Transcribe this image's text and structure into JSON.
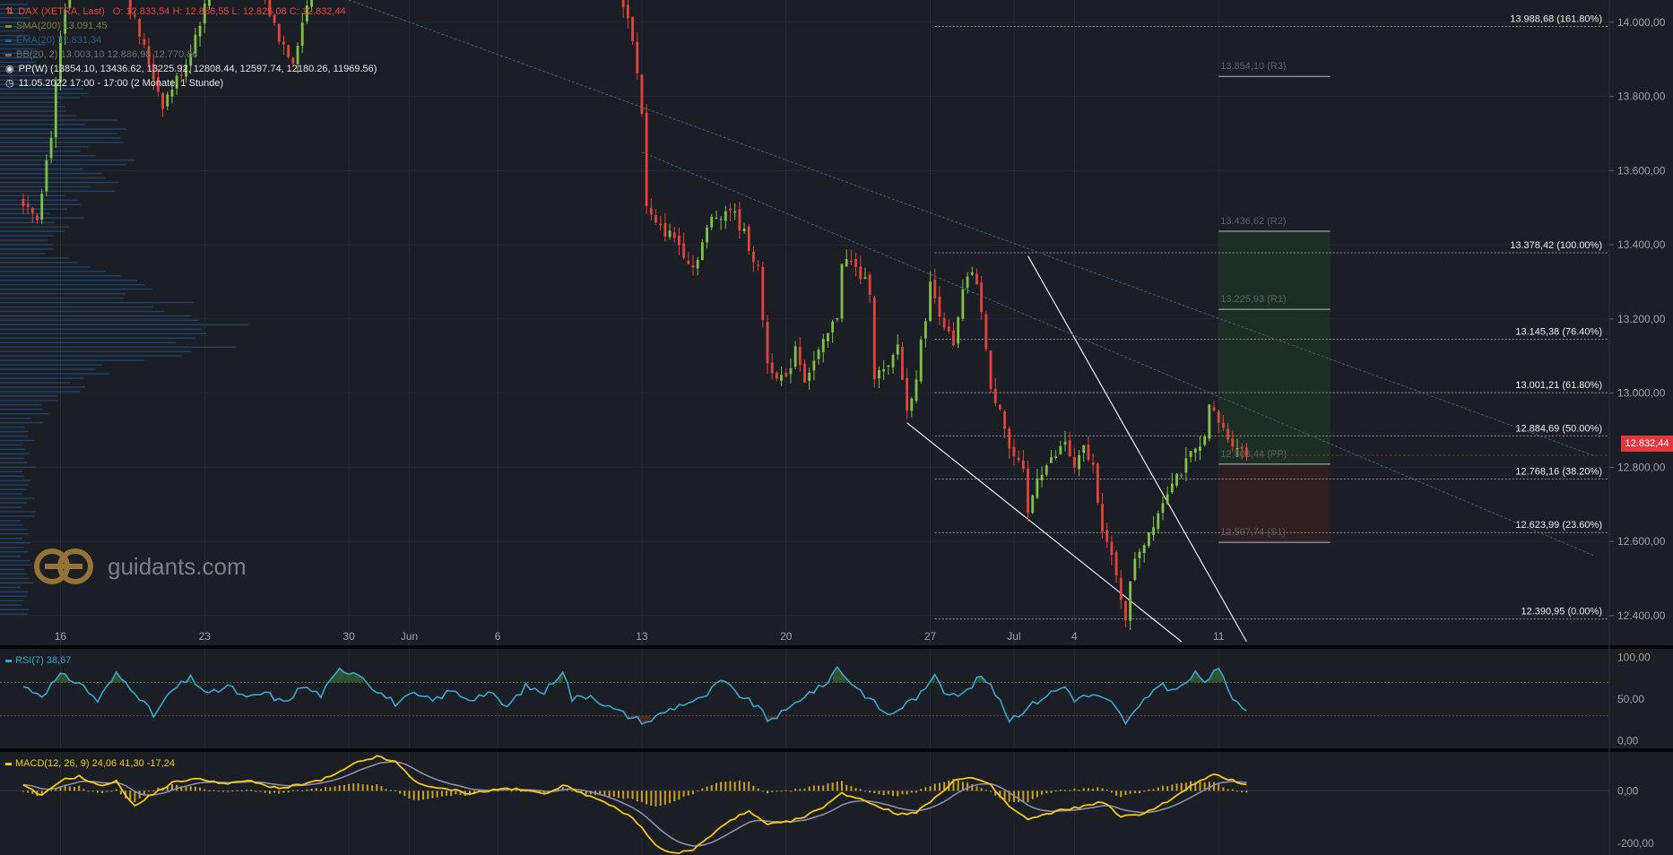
{
  "header": {
    "instrument": "DAX (XETRA, Last)",
    "ohlc": "O: 12.833,54   H: 12.856,55   L: 12.825,08   C: 12.832,44",
    "sma": "SMA(200)  13.091,45",
    "ema": "EMA(20)  12.831,34",
    "bb": "BB(20, 2)  13.003,10  12.886,98  12.770,86",
    "pp": "PP(W)   (13854.10, 13436.62, 13225.92, 12808.44, 12597.74, 12180.26, 11969.56)",
    "period": "11.05.2022 17:00 - 17:00   (2 Monate, 1 Stunde)"
  },
  "logo": {
    "text": "guidants.com"
  },
  "last_price": "12.832,44",
  "colors": {
    "background": "#1b1e24",
    "up": "#7fc04a",
    "down": "#e0443c",
    "rsi": "#3aa6cc",
    "macd": "#f2c816",
    "signal": "#8a8fa8",
    "histogram": "#c9a227",
    "volume_profile": "#1f4c78",
    "price_tag": "#e6383c"
  },
  "chart_data": [
    {
      "type": "candlestick",
      "title": "DAX (XETRA, Last)",
      "y_ticks": [
        "14.000,00",
        "13.800,00",
        "13.600,00",
        "13.400,00",
        "13.200,00",
        "13.000,00",
        "12.800,00",
        "12.600,00",
        "12.400,00"
      ],
      "y_tick_values": [
        14000,
        13800,
        13600,
        13400,
        13200,
        13000,
        12800,
        12600,
        12400
      ],
      "ylim": [
        12320,
        14060
      ],
      "x_ticks": [
        {
          "label": "16",
          "index": 8
        },
        {
          "label": "23",
          "index": 39
        },
        {
          "label": "30",
          "index": 70
        },
        {
          "label": "Jun",
          "index": 83
        },
        {
          "label": "6",
          "index": 102
        },
        {
          "label": "13",
          "index": 133
        },
        {
          "label": "20",
          "index": 164
        },
        {
          "label": "27",
          "index": 195
        },
        {
          "label": "Jul",
          "index": 213
        },
        {
          "label": "4",
          "index": 226
        },
        {
          "label": "11",
          "index": 257
        }
      ],
      "x_range": [
        -5,
        341
      ],
      "anchor_closes": [
        [
          0,
          13520
        ],
        [
          3,
          13480
        ],
        [
          6,
          13700
        ],
        [
          8,
          13950
        ],
        [
          10,
          14100
        ],
        [
          20,
          14150
        ],
        [
          30,
          13780
        ],
        [
          35,
          13890
        ],
        [
          40,
          14080
        ],
        [
          50,
          14120
        ],
        [
          55,
          13960
        ],
        [
          58,
          13900
        ],
        [
          62,
          14100
        ],
        [
          66,
          14140
        ],
        [
          70,
          14200
        ],
        [
          100,
          14300
        ],
        [
          128,
          14100
        ],
        [
          131,
          13960
        ],
        [
          133,
          13760
        ],
        [
          134,
          13500
        ],
        [
          136,
          13450
        ],
        [
          140,
          13420
        ],
        [
          144,
          13340
        ],
        [
          148,
          13470
        ],
        [
          152,
          13500
        ],
        [
          155,
          13430
        ],
        [
          158,
          13330
        ],
        [
          160,
          13080
        ],
        [
          164,
          13030
        ],
        [
          166,
          13130
        ],
        [
          168,
          13040
        ],
        [
          172,
          13130
        ],
        [
          175,
          13210
        ],
        [
          176,
          13360
        ],
        [
          178,
          13350
        ],
        [
          182,
          13280
        ],
        [
          183,
          13050
        ],
        [
          186,
          13060
        ],
        [
          188,
          13130
        ],
        [
          190,
          12950
        ],
        [
          192,
          13050
        ],
        [
          195,
          13290
        ],
        [
          200,
          13120
        ],
        [
          202,
          13270
        ],
        [
          204,
          13330
        ],
        [
          206,
          13230
        ],
        [
          208,
          13000
        ],
        [
          210,
          12970
        ],
        [
          212,
          12850
        ],
        [
          215,
          12780
        ],
        [
          216,
          12670
        ],
        [
          218,
          12780
        ],
        [
          222,
          12830
        ],
        [
          224,
          12870
        ],
        [
          226,
          12790
        ],
        [
          228,
          12850
        ],
        [
          230,
          12800
        ],
        [
          232,
          12640
        ],
        [
          234,
          12550
        ],
        [
          237,
          12400
        ],
        [
          239,
          12560
        ],
        [
          241,
          12600
        ],
        [
          244,
          12680
        ],
        [
          247,
          12770
        ],
        [
          249,
          12790
        ],
        [
          251,
          12830
        ],
        [
          253,
          12850
        ],
        [
          254,
          12900
        ],
        [
          255,
          12960
        ],
        [
          257,
          12920
        ],
        [
          259,
          12880
        ],
        [
          261,
          12860
        ],
        [
          263,
          12832
        ]
      ],
      "fibonacci": [
        {
          "label": "13.988,68 (161.80%)",
          "value": 13988.68
        },
        {
          "label": "13.378,42 (100.00%)",
          "value": 13378.42
        },
        {
          "label": "13.145,38 (76.40%)",
          "value": 13145.38
        },
        {
          "label": "13.001,21 (61.80%)",
          "value": 13001.21
        },
        {
          "label": "12.884,69 (50.00%)",
          "value": 12884.69
        },
        {
          "label": "12.768,16 (38.20%)",
          "value": 12768.16
        },
        {
          "label": "12.623,99 (23.60%)",
          "value": 12623.99
        },
        {
          "label": "12.390,95 (0.00%)",
          "value": 12390.95
        }
      ],
      "pivots": [
        {
          "label": "13.854,10 (R3)",
          "value": 13854.1
        },
        {
          "label": "13.436,62 (R2)",
          "value": 13436.62
        },
        {
          "label": "13.225,93 (R1)",
          "value": 13225.93
        },
        {
          "label": "12.808,44 (PP)",
          "value": 12808.44
        },
        {
          "label": "12.597,74 (S1)",
          "value": 12597.74
        }
      ],
      "trendlines": [
        {
          "name": "channel-upper",
          "from": [
            216,
            13370
          ],
          "to": [
            263,
            12330
          ]
        },
        {
          "name": "channel-lower",
          "from": [
            190,
            12920
          ],
          "to": [
            249,
            12330
          ]
        },
        {
          "name": "long-trend-1",
          "from": [
            70,
            14060
          ],
          "to": [
            338,
            12830
          ]
        },
        {
          "name": "long-trend-2",
          "from": [
            133,
            13650
          ],
          "to": [
            338,
            12560
          ]
        }
      ],
      "last_price": 12832.44
    },
    {
      "type": "line",
      "title": "RSI(7)",
      "value_label": "RSI(7)  38,67",
      "y_ticks": [
        "100,00",
        "50,00",
        "0,00"
      ],
      "y_tick_values": [
        100,
        50,
        0
      ],
      "ylim": [
        -8,
        108
      ],
      "levels": [
        70,
        30
      ],
      "anchors": [
        [
          0,
          65
        ],
        [
          4,
          55
        ],
        [
          8,
          78
        ],
        [
          12,
          70
        ],
        [
          16,
          48
        ],
        [
          20,
          80
        ],
        [
          24,
          60
        ],
        [
          28,
          30
        ],
        [
          32,
          60
        ],
        [
          36,
          75
        ],
        [
          40,
          55
        ],
        [
          44,
          66
        ],
        [
          48,
          50
        ],
        [
          52,
          58
        ],
        [
          56,
          45
        ],
        [
          60,
          65
        ],
        [
          64,
          55
        ],
        [
          68,
          85
        ],
        [
          72,
          82
        ],
        [
          76,
          60
        ],
        [
          80,
          45
        ],
        [
          84,
          55
        ],
        [
          88,
          48
        ],
        [
          92,
          60
        ],
        [
          96,
          50
        ],
        [
          100,
          58
        ],
        [
          104,
          40
        ],
        [
          108,
          65
        ],
        [
          112,
          58
        ],
        [
          116,
          85
        ],
        [
          118,
          50
        ],
        [
          122,
          55
        ],
        [
          126,
          40
        ],
        [
          130,
          30
        ],
        [
          134,
          22
        ],
        [
          138,
          35
        ],
        [
          142,
          45
        ],
        [
          146,
          50
        ],
        [
          150,
          72
        ],
        [
          154,
          55
        ],
        [
          158,
          40
        ],
        [
          160,
          25
        ],
        [
          164,
          35
        ],
        [
          168,
          55
        ],
        [
          172,
          65
        ],
        [
          175,
          88
        ],
        [
          178,
          70
        ],
        [
          182,
          50
        ],
        [
          186,
          30
        ],
        [
          190,
          45
        ],
        [
          194,
          60
        ],
        [
          196,
          82
        ],
        [
          198,
          60
        ],
        [
          202,
          55
        ],
        [
          206,
          78
        ],
        [
          210,
          50
        ],
        [
          212,
          25
        ],
        [
          216,
          40
        ],
        [
          220,
          55
        ],
        [
          224,
          65
        ],
        [
          226,
          50
        ],
        [
          230,
          55
        ],
        [
          234,
          45
        ],
        [
          237,
          22
        ],
        [
          240,
          40
        ],
        [
          244,
          68
        ],
        [
          248,
          60
        ],
        [
          252,
          80
        ],
        [
          254,
          72
        ],
        [
          257,
          85
        ],
        [
          260,
          52
        ],
        [
          263,
          39
        ]
      ]
    },
    {
      "type": "line",
      "title": "MACD(12, 26, 9)",
      "value_label": "MACD(12, 26, 9)  24,06  41,30  -17,24",
      "y_ticks": [
        "0,00",
        "-200,00"
      ],
      "y_tick_values": [
        0,
        -200
      ],
      "ylim": [
        -245,
        145
      ],
      "anchors": [
        [
          0,
          20
        ],
        [
          4,
          -20
        ],
        [
          8,
          40
        ],
        [
          12,
          55
        ],
        [
          16,
          20
        ],
        [
          20,
          35
        ],
        [
          24,
          -60
        ],
        [
          28,
          -10
        ],
        [
          32,
          30
        ],
        [
          36,
          45
        ],
        [
          40,
          40
        ],
        [
          44,
          25
        ],
        [
          48,
          40
        ],
        [
          52,
          20
        ],
        [
          56,
          10
        ],
        [
          60,
          25
        ],
        [
          64,
          40
        ],
        [
          68,
          70
        ],
        [
          72,
          110
        ],
        [
          76,
          130
        ],
        [
          80,
          110
        ],
        [
          84,
          40
        ],
        [
          88,
          10
        ],
        [
          92,
          5
        ],
        [
          96,
          -10
        ],
        [
          100,
          0
        ],
        [
          104,
          10
        ],
        [
          108,
          0
        ],
        [
          112,
          -10
        ],
        [
          116,
          20
        ],
        [
          120,
          -5
        ],
        [
          124,
          -40
        ],
        [
          128,
          -70
        ],
        [
          132,
          -120
        ],
        [
          136,
          -210
        ],
        [
          140,
          -240
        ],
        [
          144,
          -225
        ],
        [
          148,
          -170
        ],
        [
          152,
          -110
        ],
        [
          156,
          -80
        ],
        [
          160,
          -130
        ],
        [
          164,
          -120
        ],
        [
          168,
          -100
        ],
        [
          172,
          -60
        ],
        [
          176,
          -10
        ],
        [
          180,
          -30
        ],
        [
          184,
          -60
        ],
        [
          188,
          -90
        ],
        [
          192,
          -80
        ],
        [
          196,
          -30
        ],
        [
          200,
          40
        ],
        [
          204,
          50
        ],
        [
          208,
          20
        ],
        [
          212,
          -60
        ],
        [
          216,
          -110
        ],
        [
          220,
          -90
        ],
        [
          224,
          -70
        ],
        [
          228,
          -60
        ],
        [
          232,
          -40
        ],
        [
          236,
          -100
        ],
        [
          240,
          -90
        ],
        [
          244,
          -60
        ],
        [
          248,
          -20
        ],
        [
          252,
          30
        ],
        [
          256,
          60
        ],
        [
          260,
          40
        ],
        [
          263,
          24
        ]
      ]
    }
  ]
}
